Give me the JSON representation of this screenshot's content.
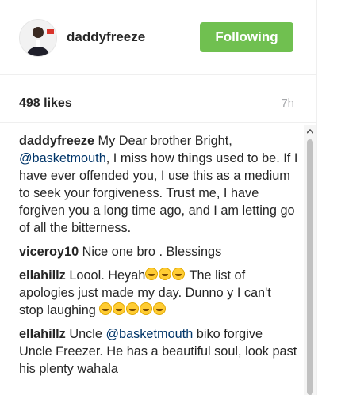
{
  "post": {
    "username": "daddyfreeze",
    "follow_label": "Following",
    "likes": "498 likes",
    "time_ago": "7h"
  },
  "comments": [
    {
      "user": "daddyfreeze",
      "parts": [
        " My Dear brother Bright, ",
        "@basketmouth",
        ", I miss how things used to be. If I have ever offended you, I use this as a medium to seek your forgiveness. Trust me, I have forgiven you a long time ago, and I am letting go of all the bitterness."
      ]
    },
    {
      "user": "viceroy10",
      "text": " Nice one bro . Blessings"
    },
    {
      "user": "ellahillz",
      "text_a": " Loool. Heyah",
      "text_b": " The list of apologies just made my day. Dunno y I can't stop laughing "
    },
    {
      "user": "ellahillz",
      "text_a": " Uncle ",
      "mention": "@basketmouth",
      "text_b": " biko forgive Uncle Freezer. He has a beautiful soul, look past his plenty wahala"
    }
  ],
  "icons": {
    "avatar": "profile-photo",
    "scroll_up": "chevron-up-icon",
    "emoji": "laughing-emoji-icon"
  },
  "colors": {
    "follow_button": "#70c050",
    "mention": "#003569",
    "muted": "#a5a7aa"
  }
}
